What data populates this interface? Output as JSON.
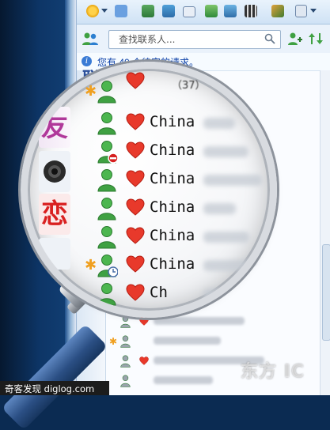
{
  "search": {
    "placeholder": "查找联系人..."
  },
  "notice": {
    "text": "您有 40 个待定的请求。"
  },
  "group": {
    "count_label": "（37）"
  },
  "tabs": [
    {
      "label": "联",
      "color": "#2b4f9a"
    },
    {
      "label": "友",
      "color": "#b0389a"
    },
    {
      "label": "恋",
      "color": "#d92020"
    }
  ],
  "contacts": [
    {
      "name": "China",
      "status": "online",
      "starred": false
    },
    {
      "name": "China",
      "status": "busy",
      "starred": false
    },
    {
      "name": "China",
      "status": "online",
      "starred": false
    },
    {
      "name": "China",
      "status": "online",
      "starred": false
    },
    {
      "name": "China",
      "status": "online",
      "starred": false
    },
    {
      "name": "China",
      "status": "away",
      "starred": true
    },
    {
      "name": "Ch",
      "status": "online",
      "starred": false
    }
  ],
  "watermark": {
    "left": "奇客发现 diglog.com",
    "right": "东方 IC"
  },
  "colors": {
    "accent": "#2a6fc9",
    "heart": "#e8392b",
    "avatar": "#3fa142"
  }
}
